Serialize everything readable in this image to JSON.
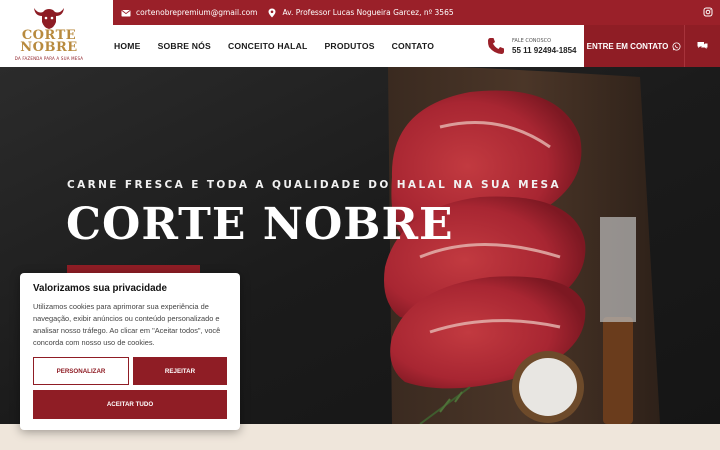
{
  "brand": {
    "name_line1": "CORTE",
    "name_line2": "NOBRE",
    "tagline": "DA FAZENDA PARA A SUA MESA",
    "colors": {
      "primary": "#8f1d25",
      "gold": "#b88a3e"
    }
  },
  "topbar": {
    "email": "cortenobrepremium@gmail.com",
    "address": "Av. Professor Lucas Nogueira Garcez, nº 3565",
    "icons": [
      "envelope-icon",
      "location-pin-icon",
      "instagram-icon"
    ]
  },
  "nav": {
    "items": [
      "HOME",
      "SOBRE NÓS",
      "CONCEITO HALAL",
      "PRODUTOS",
      "CONTATO"
    ]
  },
  "contact": {
    "label": "FALE CONOSCO",
    "phone": "55 11 92494-1854",
    "cta": "ENTRE EM CONTATO"
  },
  "hero": {
    "subtitle": "CARNE FRESCA E TODA A QUALIDADE DO HALAL NA SUA MESA",
    "title": "CORTE NOBRE"
  },
  "cookie": {
    "title": "Valorizamos sua privacidade",
    "text": "Utilizamos cookies para aprimorar sua experiência de navegação, exibir anúncios ou conteúdo personalizado e analisar nosso tráfego. Ao clicar em \"Aceitar todos\", você concorda com nosso uso de cookies.",
    "customize": "PERSONALIZAR",
    "reject": "REJEITAR",
    "accept": "ACEITAR TUDO"
  }
}
